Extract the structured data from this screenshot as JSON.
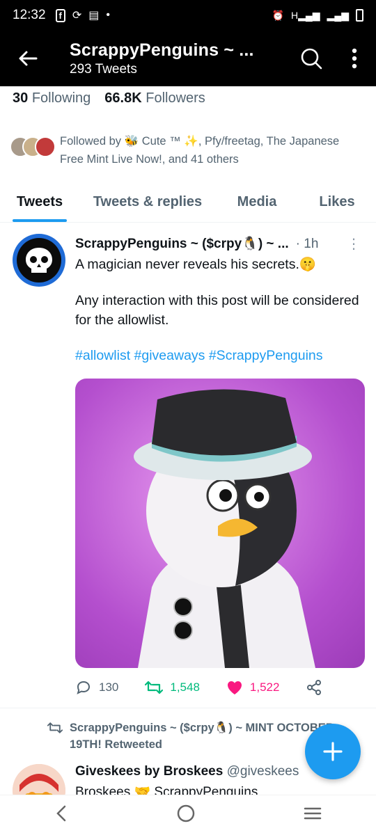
{
  "status_bar": {
    "time": "12:32",
    "left_icons": [
      "facebook-icon",
      "sync-icon",
      "wallet-icon",
      "dot-icon"
    ],
    "right_icons": [
      "alarm-icon",
      "signal-h-icon",
      "signal-icon",
      "battery-icon"
    ],
    "network_label": "H"
  },
  "header": {
    "title": "ScrappyPenguins ~ ...",
    "subtitle": "293 Tweets"
  },
  "stats": {
    "following_count": "30",
    "following_label": "Following",
    "followers_count": "66.8K",
    "followers_label": "Followers"
  },
  "followed_by": {
    "text": "Followed by 🐝 Cute ™ ✨, Pfy/freetag, The Japanese Free Mint Live Now!, and 41 others"
  },
  "tabs": [
    {
      "label": "Tweets",
      "active": true
    },
    {
      "label": "Tweets & replies",
      "active": false
    },
    {
      "label": "Media",
      "active": false
    },
    {
      "label": "Likes",
      "active": false
    }
  ],
  "tweet": {
    "author": "ScrappyPenguins ~ ($crpy🐧) ~ ...",
    "time": "· 1h",
    "line1": "A magician never reveals his secrets.🤫",
    "line2": "Any interaction with this post will be considered for the allowlist.",
    "hashtags": "#allowlist #giveaways #ScrappyPenguins",
    "replies": "130",
    "retweets": "1,548",
    "likes": "1,522"
  },
  "retweet_notice": {
    "text": "ScrappyPenguins ~ ($crpy🐧) ~ MINT OCTOBER 19TH! Retweeted"
  },
  "tweet2": {
    "author": "Giveskees by Broskees",
    "handle": "@giveskees",
    "text": "Broskees 🤝 ScrappyPenguins"
  },
  "colors": {
    "accent": "#1d9bf0",
    "retweet": "#00ba7c",
    "like": "#f91880",
    "media_bg": "#b44fce"
  }
}
